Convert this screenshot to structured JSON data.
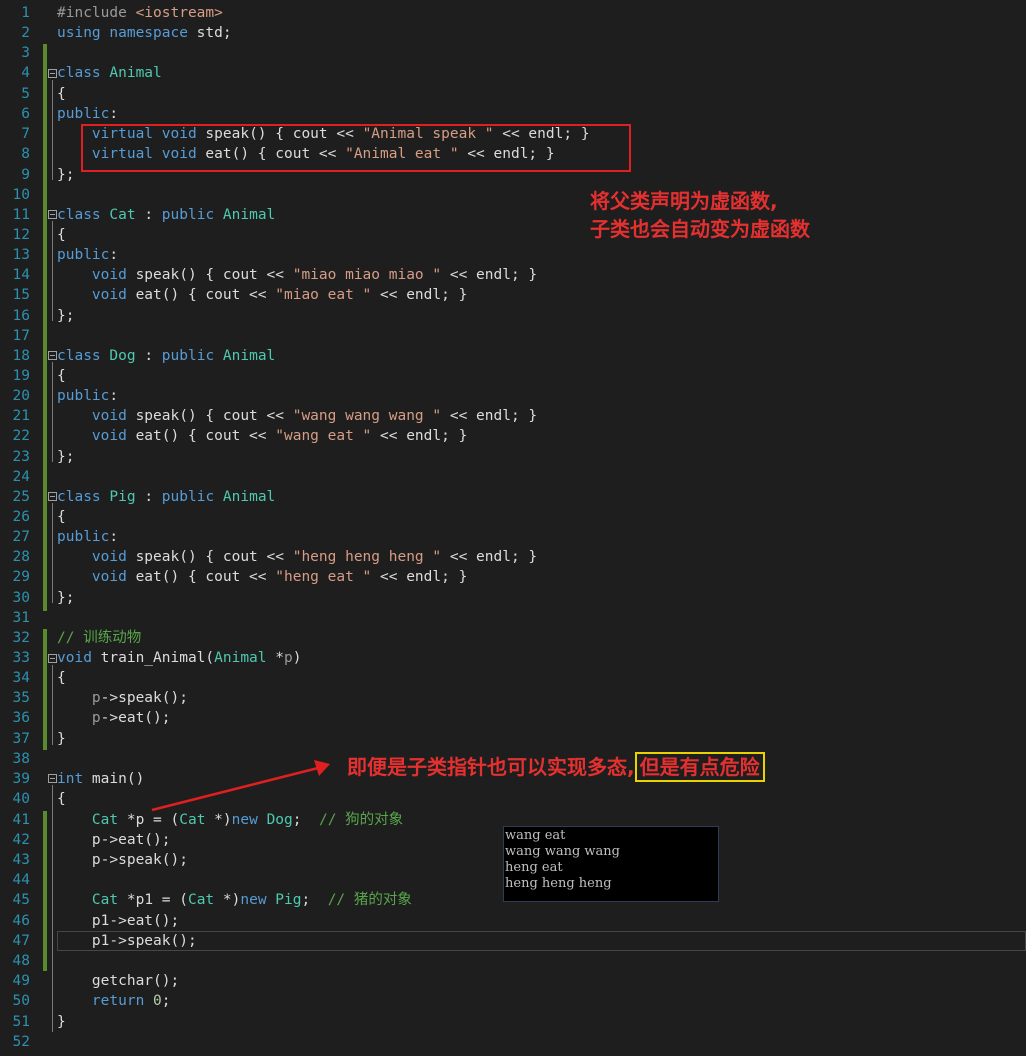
{
  "line_numbers": [
    "1",
    "2",
    "3",
    "4",
    "5",
    "6",
    "7",
    "8",
    "9",
    "10",
    "11",
    "12",
    "13",
    "14",
    "15",
    "16",
    "17",
    "18",
    "19",
    "20",
    "21",
    "22",
    "23",
    "24",
    "25",
    "26",
    "27",
    "28",
    "29",
    "30",
    "31",
    "32",
    "33",
    "34",
    "35",
    "36",
    "37",
    "38",
    "39",
    "40",
    "41",
    "42",
    "43",
    "44",
    "45",
    "46",
    "47",
    "48",
    "49",
    "50",
    "51",
    "52"
  ],
  "code": {
    "l1": {
      "a": "#include ",
      "b": "<iostream>"
    },
    "l2": {
      "a": "using namespace",
      "b": " std;"
    },
    "l4": {
      "a": "class ",
      "b": "Animal"
    },
    "l5": {
      "a": "{"
    },
    "l6": {
      "a": "public",
      ":": ":"
    },
    "l7": {
      "a": "    virtual void",
      " b": " speak() { cout << ",
      "c": "\"Animal speak \"",
      "d": " << endl; }"
    },
    "l8": {
      "a": "    virtual void",
      "b": " eat() { cout << ",
      "c": "\"Animal eat \"",
      "d": " << endl; }"
    },
    "l9": {
      "a": "};"
    },
    "l11": {
      "a": "class ",
      "b": "Cat",
      ":": " : ",
      "c": "public ",
      "d": "Animal"
    },
    "l12": {
      "a": "{"
    },
    "l13": {
      "a": "public",
      "b": ":"
    },
    "l14": {
      "a": "    void",
      "b": " speak() { cout << ",
      "c": "\"miao miao miao \"",
      "d": " << endl; }"
    },
    "l15": {
      "a": "    void",
      "b": " eat() { cout << ",
      "c": "\"miao eat \"",
      "d": " << endl; }"
    },
    "l16": {
      "a": "};"
    },
    "l18": {
      "a": "class ",
      "b": "Dog",
      "c": " : ",
      "d": "public ",
      "e": "Animal"
    },
    "l19": {
      "a": "{"
    },
    "l20": {
      "a": "public",
      "b": ":"
    },
    "l21": {
      "a": "    void",
      "b": " speak() { cout << ",
      "c": "\"wang wang wang \"",
      "d": " << endl; }"
    },
    "l22": {
      "a": "    void",
      "b": " eat() { cout << ",
      "c": "\"wang eat \"",
      "d": " << endl; }"
    },
    "l23": {
      "a": "};"
    },
    "l25": {
      "a": "class ",
      "b": "Pig",
      "c": " : ",
      "d": "public ",
      "e": "Animal"
    },
    "l26": {
      "a": "{"
    },
    "l27": {
      "a": "public",
      "b": ":"
    },
    "l28": {
      "a": "    void",
      "b": " speak() { cout << ",
      "c": "\"heng heng heng \"",
      "d": " << endl; }"
    },
    "l29": {
      "a": "    void",
      "b": " eat() { cout << ",
      "c": "\"heng eat \"",
      "d": " << endl; }"
    },
    "l30": {
      "a": "};"
    },
    "l32": {
      "a": "// 训练动物"
    },
    "l33": {
      "a": "void",
      "b": " train_Animal(",
      "c": "Animal",
      "d": " *",
      "e": "p",
      ")": ")"
    },
    "l34": {
      "a": "{"
    },
    "l35": {
      "a": "    ",
      "b": "p",
      "c": "->speak();"
    },
    "l36": {
      "a": "    ",
      "b": "p",
      "c": "->eat();"
    },
    "l37": {
      "a": "}"
    },
    "l39": {
      "a": "int",
      "b": " main()"
    },
    "l40": {
      "a": "{"
    },
    "l41": {
      "a": "    ",
      "b": "Cat",
      "c": " *p = (",
      "d": "Cat",
      "e": " *)",
      "f": "new ",
      "g": "Dog",
      "h": ";  ",
      "i": "// 狗的对象"
    },
    "l42": {
      "a": "    p->eat();"
    },
    "l43": {
      "a": "    p->speak();"
    },
    "l45": {
      "a": "    ",
      "b": "Cat",
      "c": " *p1 = (",
      "d": "Cat",
      "e": " *)",
      "f": "new ",
      "g": "Pig",
      "h": ";  ",
      "i": "// 猪的对象"
    },
    "l46": {
      "a": "    p1->eat();"
    },
    "l47": {
      "a": "    p1->speak();"
    },
    "l49": {
      "a": "    getchar();"
    },
    "l50": {
      "a": "    return ",
      "b": "0",
      "c": ";"
    },
    "l51": {
      "a": "}"
    }
  },
  "annotations": {
    "note1_line1": "将父类声明为虚函数,",
    "note1_line2": "子类也会自动变为虚函数",
    "note2_main": "即便是子类指针也可以实现多态,",
    "note2_boxed": "但是有点危险"
  },
  "console_output": [
    "wang eat",
    "wang wang wang",
    "heng eat",
    "heng heng heng"
  ],
  "colors": {
    "background": "#1e1e1e",
    "keyword": "#569cd6",
    "type": "#4ec9b0",
    "string": "#d69d85",
    "comment": "#57a64a",
    "line_number": "#2b91af",
    "annotation": "#e53030",
    "highlight_box": "#e8d200"
  }
}
